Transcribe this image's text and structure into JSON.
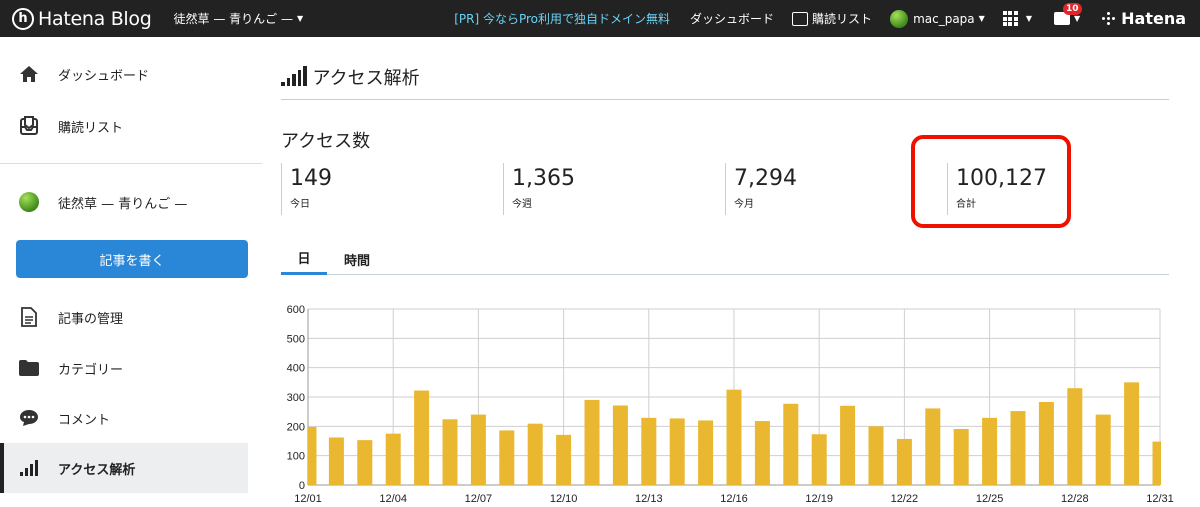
{
  "topbar": {
    "brand_mark": "h",
    "brand": "Hatena Blog",
    "blog_name": "徒然草 — 青りんご —",
    "pr_text": "[PR] 今ならPro利用で独自ドメイン無料",
    "dashboard": "ダッシュボード",
    "reader": "購読リスト",
    "username": "mac_papa",
    "notification_count": "10",
    "hatena": "Hatena"
  },
  "sidebar": {
    "dashboard": "ダッシュボード",
    "reader": "購読リスト",
    "blog_name": "徒然草 — 青りんご —",
    "write_button": "記事を書く",
    "manage_articles": "記事の管理",
    "categories": "カテゴリー",
    "comments": "コメント",
    "access_analysis": "アクセス解析"
  },
  "main": {
    "page_title": "アクセス解析",
    "section_title": "アクセス数",
    "stats": [
      {
        "value": "149",
        "label": "今日"
      },
      {
        "value": "1,365",
        "label": "今週"
      },
      {
        "value": "7,294",
        "label": "今月"
      },
      {
        "value": "100,127",
        "label": "合計"
      }
    ],
    "tabs": [
      {
        "label": "日"
      },
      {
        "label": "時間"
      }
    ]
  },
  "colors": {
    "topbar_bg": "#222222",
    "accent_blue": "#2a87d8",
    "bar_color": "#e9b730",
    "highlight_red": "#ee1100"
  },
  "chart_data": {
    "type": "bar",
    "categories": [
      "12/01",
      "12/02",
      "12/03",
      "12/04",
      "12/05",
      "12/06",
      "12/07",
      "12/08",
      "12/09",
      "12/10",
      "12/11",
      "12/12",
      "12/13",
      "12/14",
      "12/15",
      "12/16",
      "12/17",
      "12/18",
      "12/19",
      "12/20",
      "12/21",
      "12/22",
      "12/23",
      "12/24",
      "12/25",
      "12/26",
      "12/27",
      "12/28",
      "12/29",
      "12/30",
      "12/31"
    ],
    "values": [
      198,
      162,
      153,
      175,
      322,
      224,
      240,
      186,
      209,
      171,
      290,
      271,
      229,
      227,
      220,
      325,
      218,
      277,
      173,
      270,
      200,
      157,
      261,
      191,
      229,
      252,
      283,
      330,
      240,
      350,
      148
    ],
    "x_tick_labels": [
      "12/01",
      "12/04",
      "12/07",
      "12/10",
      "12/13",
      "12/16",
      "12/19",
      "12/22",
      "12/25",
      "12/28",
      "12/31"
    ],
    "y_ticks": [
      "0",
      "100",
      "200",
      "300",
      "400",
      "500",
      "600"
    ],
    "ylim": [
      0,
      600
    ],
    "grid": true
  }
}
